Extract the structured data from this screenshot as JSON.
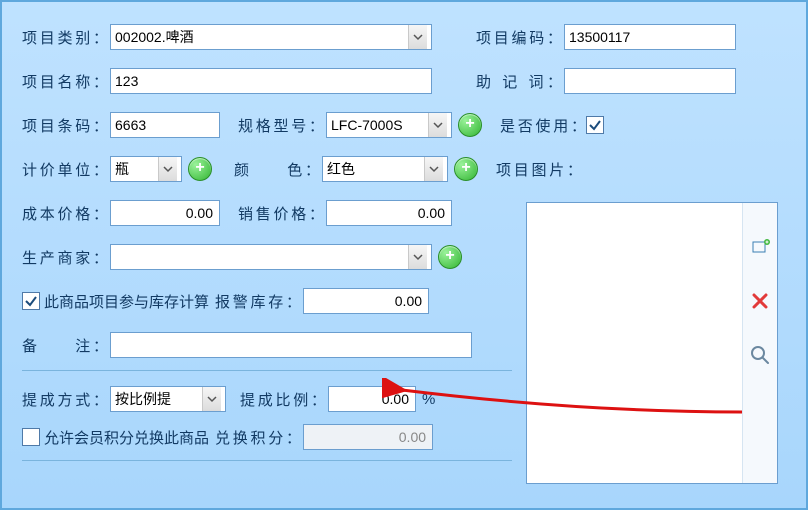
{
  "labels": {
    "category": "项目类别",
    "code": "项目编码",
    "name": "项目名称",
    "mnemonic": "助 记 词",
    "barcode": "项目条码",
    "spec": "规格型号",
    "inuse": "是否使用",
    "unit": "计价单位",
    "color": "颜　　色",
    "image": "项目图片",
    "cost": "成本价格",
    "sale": "销售价格",
    "manufacturer": "生产商家",
    "stock_chk": "此商品项目参与库存计算",
    "alarm_stock": "报警库存",
    "remark": "备　　注",
    "commission_mode": "提成方式",
    "commission_ratio": "提成比例",
    "percent": "%",
    "points_chk": "允许会员积分兑换此商品",
    "exchange_points": "兑换积分"
  },
  "values": {
    "category": "002002.啤酒",
    "code": "13500117",
    "name": "123",
    "mnemonic": "",
    "barcode": "6663",
    "spec": "LFC-7000S",
    "unit": "瓶",
    "color": "红色",
    "cost": "0.00",
    "sale": "0.00",
    "manufacturer": "",
    "alarm_stock": "0.00",
    "remark": "",
    "commission_mode": "按比例提",
    "commission_ratio": "0.00",
    "exchange_points": "0.00"
  },
  "checks": {
    "inuse": true,
    "stock": true,
    "points": false
  }
}
